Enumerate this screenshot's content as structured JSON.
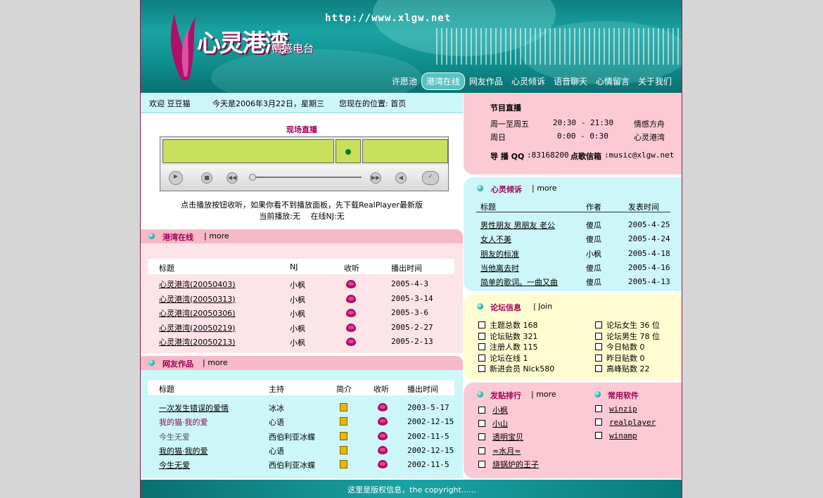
{
  "header": {
    "url": "http://www.xlgw.net",
    "logo": "心灵港湾",
    "logo_sub": "情感电台",
    "nav": [
      "许愿池",
      "港湾在线",
      "网友作品",
      "心灵倾诉",
      "语音聊天",
      "心情留言",
      "关于我们"
    ],
    "nav_active": 1
  },
  "welcome": {
    "greeting": "欢迎 豆豆猫",
    "date": "今天是2006年3月22日，星期三",
    "location": "您现在的位置: 首页"
  },
  "player": {
    "title": "现场直播",
    "hint": "点击播放按钮收听，如果你看不到播放面板，先下载RealPlayer最新版",
    "now_playing": "当前播放:无　 在线NJ:无"
  },
  "harbor": {
    "title": "港湾在线",
    "more": "| more",
    "headers": [
      "标题",
      "NJ",
      "收听",
      "播出时间"
    ],
    "rows": [
      {
        "title": "心灵港湾(20050403)",
        "nj": "小枫",
        "date": "2005-4-3"
      },
      {
        "title": "心灵港湾(20050313)",
        "nj": "小枫",
        "date": "2005-3-14"
      },
      {
        "title": "心灵港湾(20050306)",
        "nj": "小枫",
        "date": "2005-3-6"
      },
      {
        "title": "心灵港湾(20050219)",
        "nj": "小枫",
        "date": "2005-2-27"
      },
      {
        "title": "心灵港湾(20050213)",
        "nj": "小枫",
        "date": "2005-2-13"
      }
    ]
  },
  "works": {
    "title": "网友作品",
    "more": "| more",
    "headers": [
      "标题",
      "主持",
      "简介",
      "收听",
      "播出时间"
    ],
    "rows": [
      {
        "title": "一次发生错误的爱情",
        "host": "冰冰",
        "date": "2003-5-17",
        "style": "link"
      },
      {
        "title": "我的猫·我的爱",
        "host": "心语",
        "date": "2002-12-15",
        "style": "magenta"
      },
      {
        "title": "今生无爱",
        "host": "西伯利亚冰蝶",
        "date": "2002-11-5",
        "style": "plain"
      },
      {
        "title": "我的猫·我的爱",
        "host": "心语",
        "date": "2002-12-15",
        "style": "link"
      },
      {
        "title": "今生无爱",
        "host": "西伯利亚冰蝶",
        "date": "2002-11-5",
        "style": "link"
      }
    ]
  },
  "schedule": {
    "title": "节目直播",
    "rows": [
      {
        "day": "周一至周五",
        "time": "20:30 - 21:30",
        "show": "情感方舟"
      },
      {
        "day": "周日",
        "time": "0:00 - 0:30",
        "show": "心灵港湾"
      }
    ],
    "qq_label": "导 播 QQ",
    "qq": ":83168200",
    "mail_label": "点歌信箱",
    "mail": ":music@xlgw.net"
  },
  "confide": {
    "title": "心灵倾诉",
    "more": "| more",
    "headers": [
      "标题",
      "作者",
      "发表时间"
    ],
    "rows": [
      {
        "title": "男性朋友 男朋友 老公",
        "author": "傻瓜",
        "date": "2005-4-25"
      },
      {
        "title": "女人不美",
        "author": "傻瓜",
        "date": "2005-4-24"
      },
      {
        "title": "朋友的标准",
        "author": "小枫",
        "date": "2005-4-18"
      },
      {
        "title": "当他离去时",
        "author": "傻瓜",
        "date": "2005-4-16"
      },
      {
        "title": "简单的歌词。一曲又曲",
        "author": "傻瓜",
        "date": "2005-4-13"
      }
    ]
  },
  "forum": {
    "title": "论坛信息",
    "join": "| Join",
    "left": [
      "主题总数 168",
      "论坛贴数 321",
      "注册人数 115",
      "论坛在线 1",
      "新进会员 Nick580"
    ],
    "right": [
      "论坛女生 36 位",
      "论坛男生 78 位",
      "今日帖数 0",
      "昨日贴数 0",
      "高峰贴数 22"
    ]
  },
  "ranking": {
    "title": "发贴排行",
    "more": "| more",
    "items": [
      "小枫",
      "小山",
      "透明宝贝",
      "≈水月≈",
      "烧锅炉的王子"
    ]
  },
  "software": {
    "title": "常用软件",
    "items": [
      "winzip",
      "realplayer",
      "winamp"
    ]
  },
  "footer": "这里是版权信息，the copyright......"
}
